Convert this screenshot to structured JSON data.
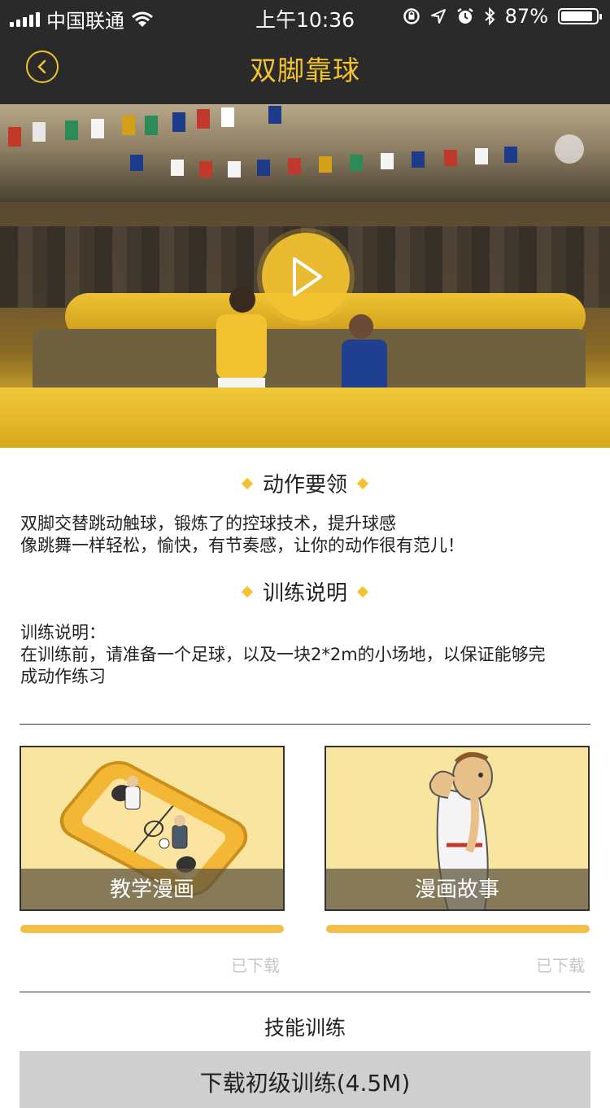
{
  "status_bar": {
    "carrier": "中国联通",
    "time": "上午10:36",
    "battery": "87%",
    "battery_level": 0.87,
    "icons": [
      "signal-icon",
      "wifi-icon",
      "orientation-lock-icon",
      "location-icon",
      "alarm-icon",
      "bluetooth-icon",
      "battery-icon"
    ]
  },
  "nav": {
    "title": "双脚靠球",
    "back_icon": "chevron-left-icon"
  },
  "hero": {
    "play_icon": "play-icon"
  },
  "colors": {
    "accent": "#f2c230",
    "header_bg": "#2a2a2a",
    "progress": "#f2c04a",
    "muted_text": "#c8c8c8"
  },
  "sections": {
    "key_points": {
      "title": "动作要领",
      "lines": [
        "双脚交替跳动触球，锻炼了的控球技术，提升球感",
        "像跳舞一样轻松，愉快，有节奏感，让你的动作很有范儿！"
      ]
    },
    "training": {
      "title": "训练说明",
      "lines": [
        "训练说明：",
        "在训练前，请准备一个足球，以及一块2*2m的小场地，以保证能够完",
        "成动作练习"
      ]
    }
  },
  "cards": [
    {
      "label": "教学漫画",
      "progress": 1.0,
      "status": "已下载"
    },
    {
      "label": "漫画故事",
      "progress": 1.0,
      "status": "已下载"
    }
  ],
  "skill": {
    "title": "技能训练",
    "download_button": "下载初级训练(4.5M)"
  }
}
